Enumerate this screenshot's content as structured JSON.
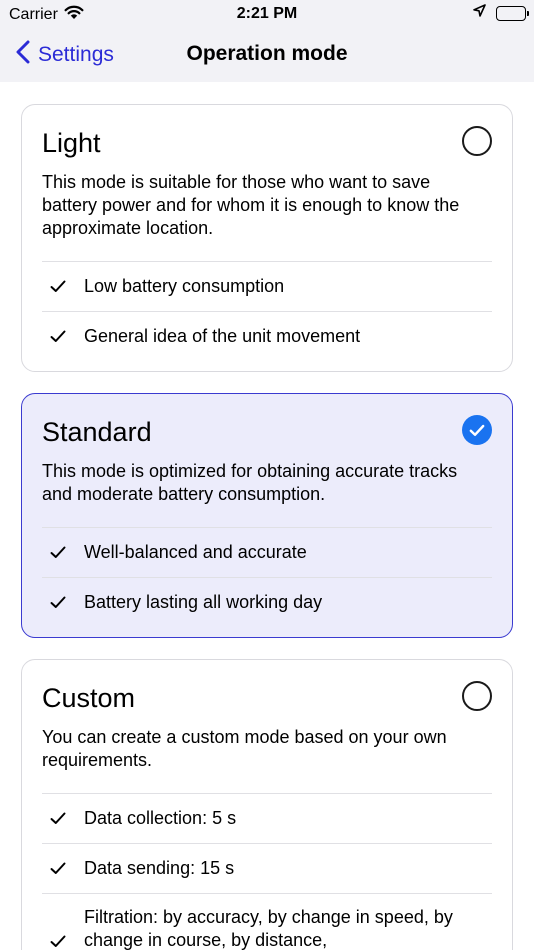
{
  "status": {
    "carrier": "Carrier",
    "time": "2:21 PM"
  },
  "nav": {
    "back_label": "Settings",
    "title": "Operation mode"
  },
  "modes": [
    {
      "title": "Light",
      "selected": false,
      "description": "This mode is suitable for those who want to save battery power and for whom it is enough to know the approximate location.",
      "features": [
        "Low battery consumption",
        "General idea of the unit movement"
      ]
    },
    {
      "title": "Standard",
      "selected": true,
      "description": "This mode is optimized for obtaining accurate tracks and moderate battery consumption.",
      "features": [
        "Well-balanced and accurate",
        "Battery lasting all working day"
      ]
    },
    {
      "title": "Custom",
      "selected": false,
      "description": "You can create a custom mode based on your own requirements.",
      "features": [
        "Data collection: 5 s",
        "Data sending: 15 s",
        "Filtration: by accuracy, by change in speed, by change in course, by distance,"
      ]
    }
  ],
  "colors": {
    "accent": "#2b2bd6",
    "selected_bg": "#ececfb",
    "check_blue": "#1a73f0"
  }
}
